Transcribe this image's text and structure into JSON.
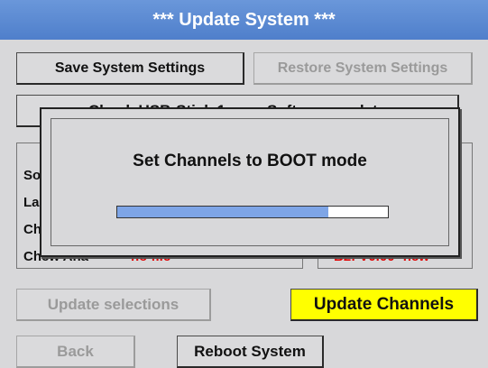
{
  "title": "***  Update System  ***",
  "buttons": {
    "save": "Save System Settings",
    "restore": "Restore System Settings",
    "check_usb": "Check USB-Stick 1",
    "software_update": "Software update",
    "update_selections": "Update selections",
    "update_channels": "Update Channels",
    "back": "Back",
    "reboot": "Reboot System"
  },
  "left_rows": [
    "So",
    "La",
    "Ch",
    "Chew Ana"
  ],
  "left_value": "-no file-",
  "right_value": "B2: V0.00  -new-",
  "dialog": {
    "message": "Set Channels to BOOT mode",
    "progress": 0.78
  },
  "colors": {
    "title_bar": "#5a88d2",
    "highlight_button": "#ffff00",
    "progress_fill": "#7ea5e6",
    "status_red": "#e00000"
  }
}
